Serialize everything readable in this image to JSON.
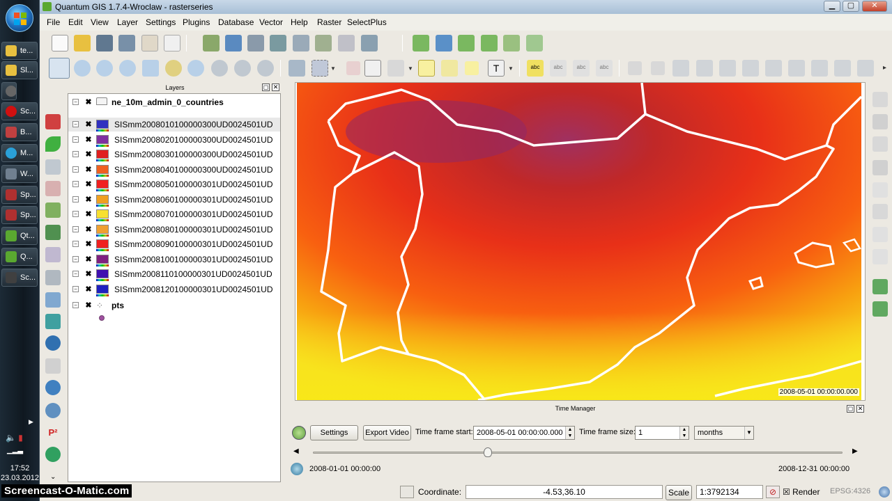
{
  "window": {
    "title": "Quantum GIS 1.7.4-Wroclaw - rasterseries"
  },
  "menu": [
    "File",
    "Edit",
    "View",
    "Layer",
    "Settings",
    "Plugins",
    "Database",
    "Vector",
    "Help",
    "Raster",
    "SelectPlus"
  ],
  "taskbar": {
    "items": [
      "te...",
      "Sl...",
      "Sc...",
      "B...",
      "M...",
      "W...",
      "Sp...",
      "Sp...",
      "Qt...",
      "Q...",
      "Sc..."
    ],
    "clock_time": "17:52",
    "clock_date": "23.03.2012"
  },
  "layers_panel": {
    "title": "Layers",
    "layers": [
      {
        "name": "ne_10m_admin_0_countries",
        "type": "vector",
        "color": "#f4f4f4"
      },
      {
        "name": "SISmm2008010100000300UD0024501UD",
        "type": "raster",
        "color": "#3030c0"
      },
      {
        "name": "SISmm2008020100000300UD0024501UD",
        "type": "raster",
        "color": "#8030a0"
      },
      {
        "name": "SISmm2008030100000300UD0024501UD",
        "type": "raster",
        "color": "#e02020"
      },
      {
        "name": "SISmm2008040100000300UD0024501UD",
        "type": "raster",
        "color": "#f06020"
      },
      {
        "name": "SISmm2008050100000301UD0024501UD",
        "type": "raster",
        "color": "#f02020"
      },
      {
        "name": "SISmm2008060100000301UD0024501UD",
        "type": "raster",
        "color": "#f0a020"
      },
      {
        "name": "SISmm2008070100000301UD0024501UD",
        "type": "raster",
        "color": "#f8e030"
      },
      {
        "name": "SISmm2008080100000301UD0024501UD",
        "type": "raster",
        "color": "#f0a030"
      },
      {
        "name": "SISmm2008090100000301UD0024501UD",
        "type": "raster",
        "color": "#f02020"
      },
      {
        "name": "SISmm2008100100000301UD0024501UD",
        "type": "raster",
        "color": "#802080"
      },
      {
        "name": "SISmm2008110100000301UD0024501UD",
        "type": "raster",
        "color": "#4010b0"
      },
      {
        "name": "SISmm2008120100000301UD0024501UD",
        "type": "raster",
        "color": "#2020c0"
      },
      {
        "name": "pts",
        "type": "points",
        "color": "#a050a0"
      }
    ]
  },
  "map": {
    "timestamp": "2008-05-01 00:00:00.000"
  },
  "time_manager": {
    "title": "Time Manager",
    "settings_label": "Settings",
    "export_label": "Export Video",
    "start_label": "Time frame start:",
    "start_value": "2008-05-01 00:00:00.000",
    "size_label": "Time frame size:",
    "size_value": "1",
    "unit_value": "months",
    "range_start": "2008-01-01 00:00:00",
    "range_end": "2008-12-31 00:00:00",
    "slider_fraction": 0.33
  },
  "statusbar": {
    "coordinate_label": "Coordinate:",
    "coordinate_value": "-4.53,36.10",
    "scale_label": "Scale",
    "scale_value": "1:3792134",
    "render_label": "Render",
    "crs": "EPSG:4326"
  },
  "watermark": "Screencast-O-Matic.com"
}
